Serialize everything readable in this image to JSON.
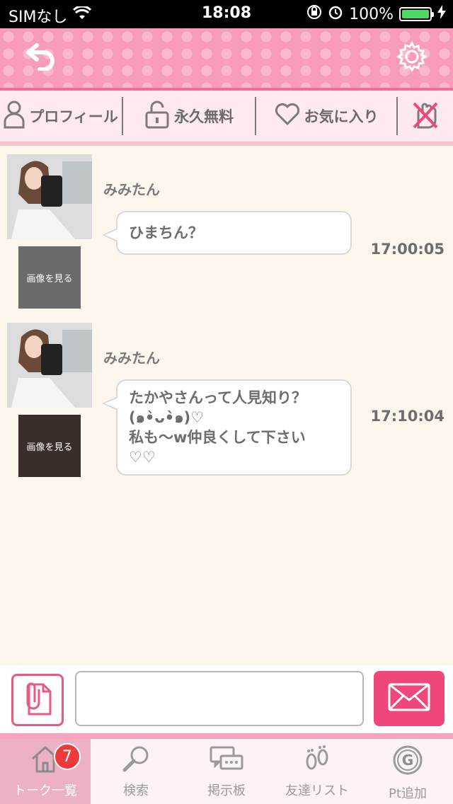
{
  "status_bar": {
    "carrier": "SIMなし",
    "time": "18:08",
    "battery_percent": "100%",
    "battery_level": 1.0
  },
  "header": {
    "back_icon": "undo-arrow-icon",
    "settings_icon": "gear-icon"
  },
  "subnav": {
    "items": [
      {
        "label": "プロフィール",
        "icon": "person-icon"
      },
      {
        "label": "永久無料",
        "icon": "lock-icon"
      },
      {
        "label": "お気に入り",
        "icon": "heart-icon"
      },
      {
        "label": "",
        "icon": "block-hand-icon"
      }
    ]
  },
  "messages": [
    {
      "sender": "みみたん",
      "text": "ひまちん？",
      "time": "17:00:05",
      "thumb_label": "画像を見る"
    },
    {
      "sender": "みみたん",
      "text": "たかやさんって人見知り？\n(๑•̀ᴗ•̀๑)♡\n私も〜w仲良くして下さい\n♡♡",
      "time": "17:10:04",
      "thumb_label": "画像を見る"
    }
  ],
  "input": {
    "value": "",
    "placeholder": ""
  },
  "tabbar": {
    "badge": "7",
    "items": [
      {
        "label": "トーク一覧",
        "icon": "home-icon"
      },
      {
        "label": "検索",
        "icon": "magnifier-icon"
      },
      {
        "label": "掲示板",
        "icon": "chat-bubbles-icon"
      },
      {
        "label": "友達リスト",
        "icon": "footprints-icon"
      },
      {
        "label": "Pt追加",
        "icon": "g-coin-icon"
      }
    ]
  },
  "colors": {
    "accent_pink": "#f0477a",
    "header_pink": "#f99cbb",
    "chat_bg": "#fdf6ec",
    "badge_red": "#ef3a3a"
  }
}
